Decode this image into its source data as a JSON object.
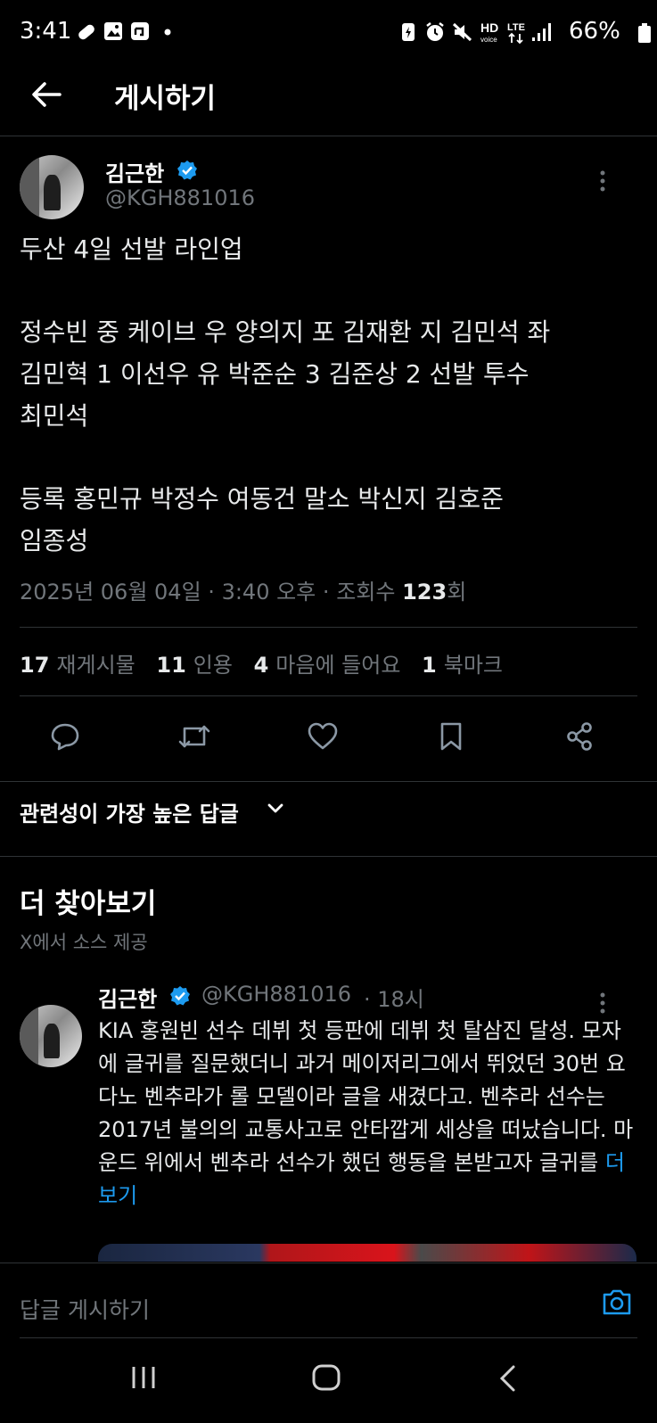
{
  "status_bar": {
    "time": "3:41",
    "battery": "66%",
    "icons": [
      "link-icon",
      "image-icon",
      "notification-icon",
      "dot-icon",
      "battery-saver-icon",
      "alarm-icon",
      "mute-icon",
      "hd-voice-icon",
      "lte-icon",
      "signal-icon",
      "battery-icon"
    ]
  },
  "header": {
    "title": "게시하기"
  },
  "tweet": {
    "author_name": "김근한",
    "author_handle": "@KGH881016",
    "line1": "두산 4일 선발 라인업",
    "para2": "정수빈 중 케이브 우 양의지 포 김재환 지 김민석 좌\n김민혁 1 이선우 유 박준순 3 김준상 2 선발 투수\n최민석",
    "para3": "등록 홍민규 박정수 여동건 말소 박신지 김호준\n임종성",
    "date": "2025년 06월 04일",
    "time": "3:40 오후",
    "views_label": "조회수",
    "views_count": "123",
    "views_suffix": "회",
    "separator": "·",
    "stats": {
      "reposts_count": "17",
      "reposts_label": "재게시물",
      "quotes_count": "11",
      "quotes_label": "인용",
      "likes_count": "4",
      "likes_label": "마음에 들어요",
      "bookmarks_count": "1",
      "bookmarks_label": "북마크"
    }
  },
  "sort": {
    "label": "관련성이 가장 높은 답글"
  },
  "explore": {
    "title": "더 찾아보기",
    "subtitle": "X에서 소스 제공"
  },
  "recommended": {
    "author_name": "김근한",
    "author_handle": "@KGH881016",
    "time": "· 18시",
    "text": "KIA 홍원빈 선수 데뷔 첫 등판에 데뷔 첫 탈삼진 달성. 모자에 글귀를 질문했더니 과거 메이저리그에서 뛰었던 30번 요다노 벤추라가 롤 모델이라 글을 새겼다고. 벤추라 선수는 2017년 불의의 교통사고로 안타깝게 세상을 떠났습니다. 마운드 위에서 벤추라 선수가 했던 행동을 본받고자 글귀를",
    "more_label": "더 보기"
  },
  "reply": {
    "placeholder": "답글 게시하기"
  },
  "colors": {
    "accent": "#1d9bf0",
    "background": "#000000",
    "text": "#e7e9ea",
    "secondary_text": "#71767b",
    "divider": "#2f3336"
  }
}
